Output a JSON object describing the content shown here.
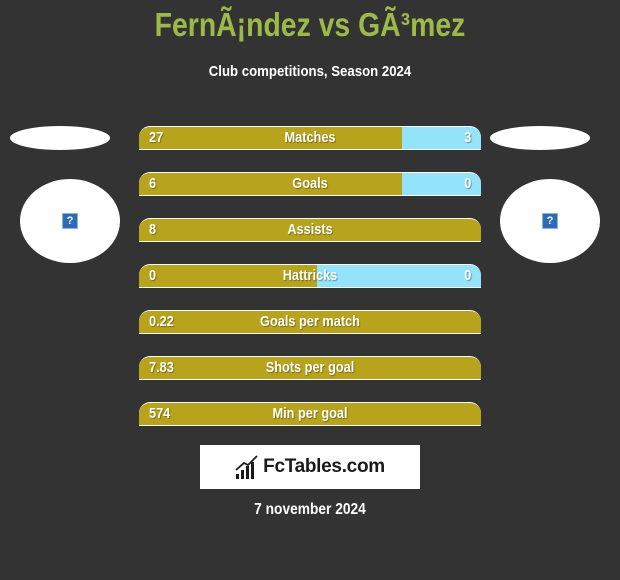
{
  "header": {
    "title": "FernÃ¡ndez vs GÃ³mez",
    "subtitle": "Club competitions, Season 2024"
  },
  "players": {
    "left": {
      "avatar_icon": "broken-image-icon",
      "glyph": "?"
    },
    "right": {
      "avatar_icon": "broken-image-icon",
      "glyph": "?"
    }
  },
  "colors": {
    "title": "#9cba4a",
    "left_bar": "#b8a41c",
    "right_bar": "#93e3fb",
    "background": "#333333"
  },
  "stats": [
    {
      "label": "Matches",
      "left": "27",
      "right": "3",
      "left_fill": 0.77
    },
    {
      "label": "Goals",
      "left": "6",
      "right": "0",
      "left_fill": 0.77
    },
    {
      "label": "Assists",
      "left": "8",
      "right": "",
      "left_fill": 1.0
    },
    {
      "label": "Hattricks",
      "left": "0",
      "right": "0",
      "left_fill": 0.52
    },
    {
      "label": "Goals per match",
      "left": "0.22",
      "right": "",
      "left_fill": 1.0
    },
    {
      "label": "Shots per goal",
      "left": "7.83",
      "right": "",
      "left_fill": 1.0
    },
    {
      "label": "Min per goal",
      "left": "574",
      "right": "",
      "left_fill": 1.0
    }
  ],
  "footer": {
    "logo_text": "FcTables.com",
    "date": "7 november 2024"
  }
}
